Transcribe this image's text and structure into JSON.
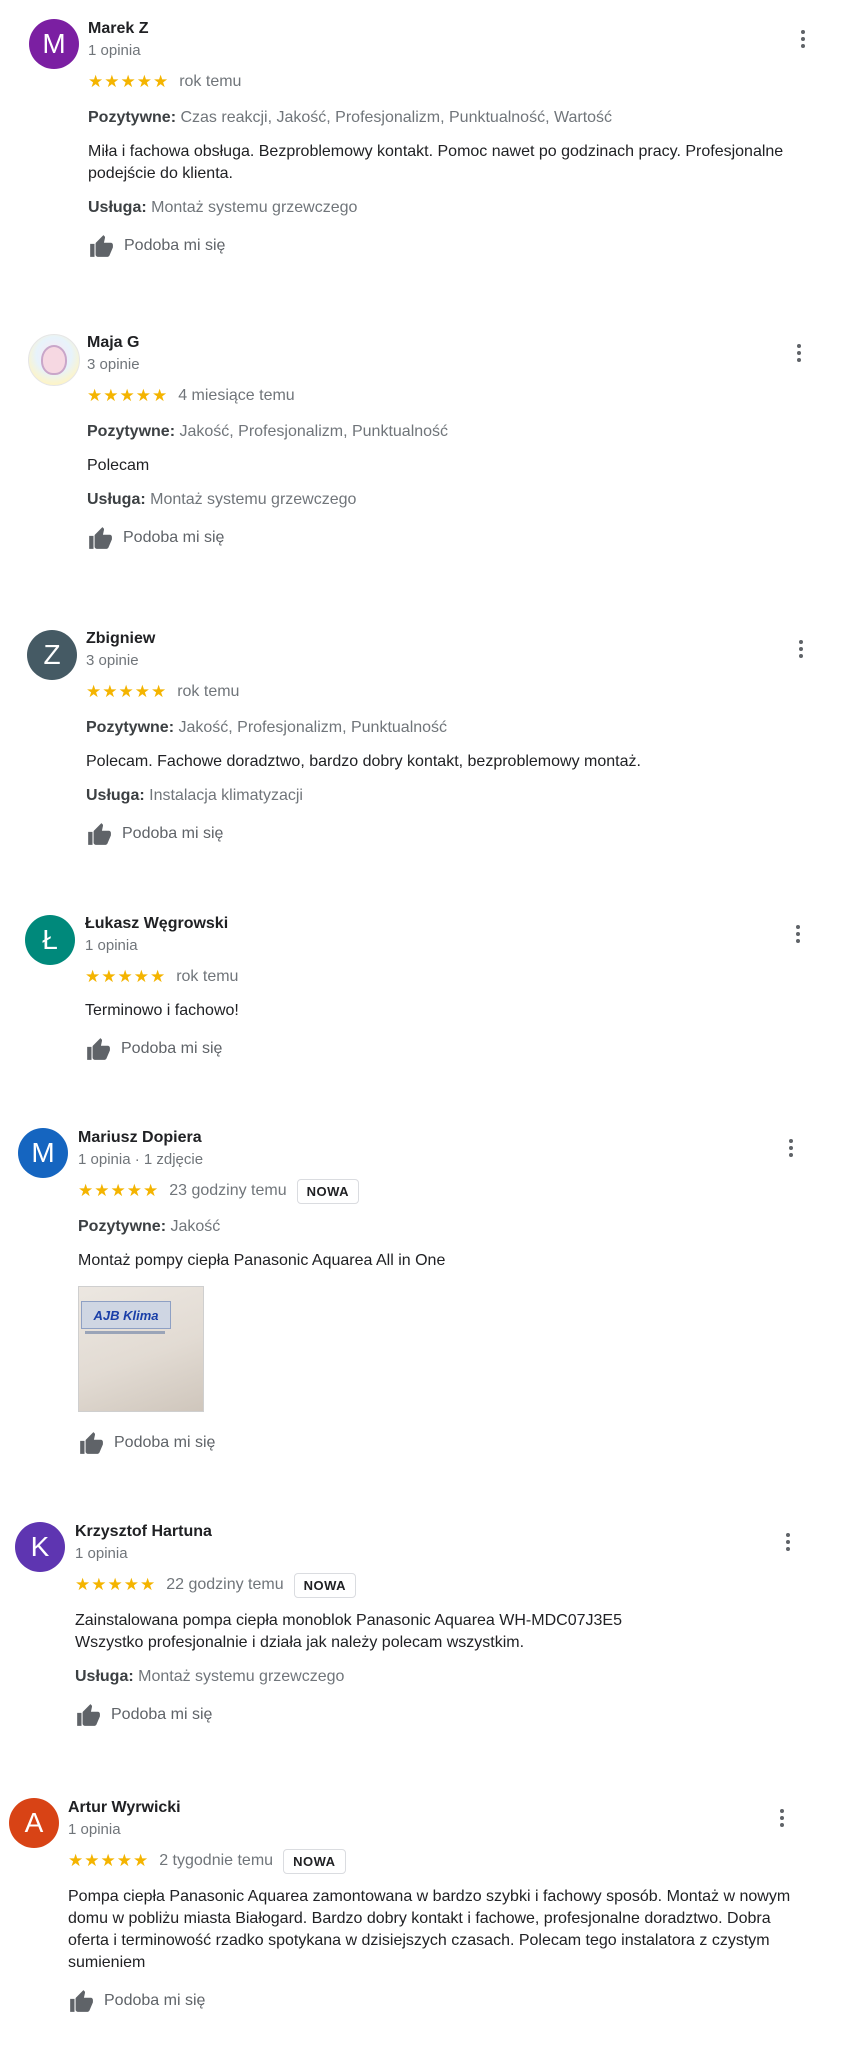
{
  "common": {
    "like_label": "Podoba mi się",
    "positive_label": "Pozytywne:",
    "service_label": "Usługa:"
  },
  "reviews": [
    {
      "name": "Marek Z",
      "initial": "M",
      "avatar_color": "#7b1fa2",
      "sub": "1 opinia",
      "stars": "★★★★★",
      "date": "rok temu",
      "positive": "Czas reakcji, Jakość, Profesjonalizm, Punktualność, Wartość",
      "text": "Miła i fachowa obsługa. Bezproblemowy kontakt. Pomoc nawet po godzinach pracy. Profesjonalne podejście do klienta.",
      "service": "Montaż systemu grzewczego"
    },
    {
      "name": "Maja G",
      "initial": "",
      "avatar_color": "",
      "sub": "3 opinie",
      "stars": "★★★★★",
      "date": "4 miesiące temu",
      "positive": "Jakość, Profesjonalizm, Punktualność",
      "text": "Polecam",
      "service": "Montaż systemu grzewczego"
    },
    {
      "name": "Zbigniew",
      "initial": "Z",
      "avatar_color": "#455a64",
      "sub": "3 opinie",
      "stars": "★★★★★",
      "date": "rok temu",
      "positive": "Jakość, Profesjonalizm, Punktualność",
      "text": "Polecam. Fachowe doradztwo, bardzo dobry kontakt, bezproblemowy montaż.",
      "service": "Instalacja klimatyzacji"
    },
    {
      "name": "Łukasz Węgrowski",
      "initial": "Ł",
      "avatar_color": "#00897b",
      "sub": "1 opinia",
      "stars": "★★★★★",
      "date": "rok temu",
      "text": "Terminowo i fachowo!"
    },
    {
      "name": "Mariusz Dopiera",
      "initial": "M",
      "avatar_color": "#1565c0",
      "sub": "1 opinia · 1 zdjęcie",
      "stars": "★★★★★",
      "date": "23 godziny temu",
      "badge": "NOWA",
      "positive": "Jakość",
      "text": "Montaż pompy ciepła Panasonic Aquarea All in One",
      "photo_sign": "AJB Klima"
    },
    {
      "name": "Krzysztof Hartuna",
      "initial": "K",
      "avatar_color": "#5e35b1",
      "sub": "1 opinia",
      "stars": "★★★★★",
      "date": "22 godziny temu",
      "badge": "NOWA",
      "text_line1": "Zainstalowana pompa ciepła monoblok Panasonic Aquarea WH-MDC07J3E5",
      "text_line2": "Wszystko profesjonalnie i działa jak należy polecam wszystkim.",
      "service": "Montaż systemu grzewczego"
    },
    {
      "name": "Artur Wyrwicki",
      "initial": "A",
      "avatar_color": "#d84315",
      "sub": "1 opinia",
      "stars": "★★★★★",
      "date": "2 tygodnie temu",
      "badge": "NOWA",
      "text": "Pompa ciepła Panasonic Aquarea zamontowana w bardzo szybki i fachowy sposób. Montaż w nowym domu w pobliżu miasta Białogard. Bardzo dobry kontakt i fachowe, profesjonalne doradztwo. Dobra oferta i terminowość rzadko spotykana w dzisiejszych czasach. Polecam tego instalatora z czystym sumieniem"
    }
  ]
}
